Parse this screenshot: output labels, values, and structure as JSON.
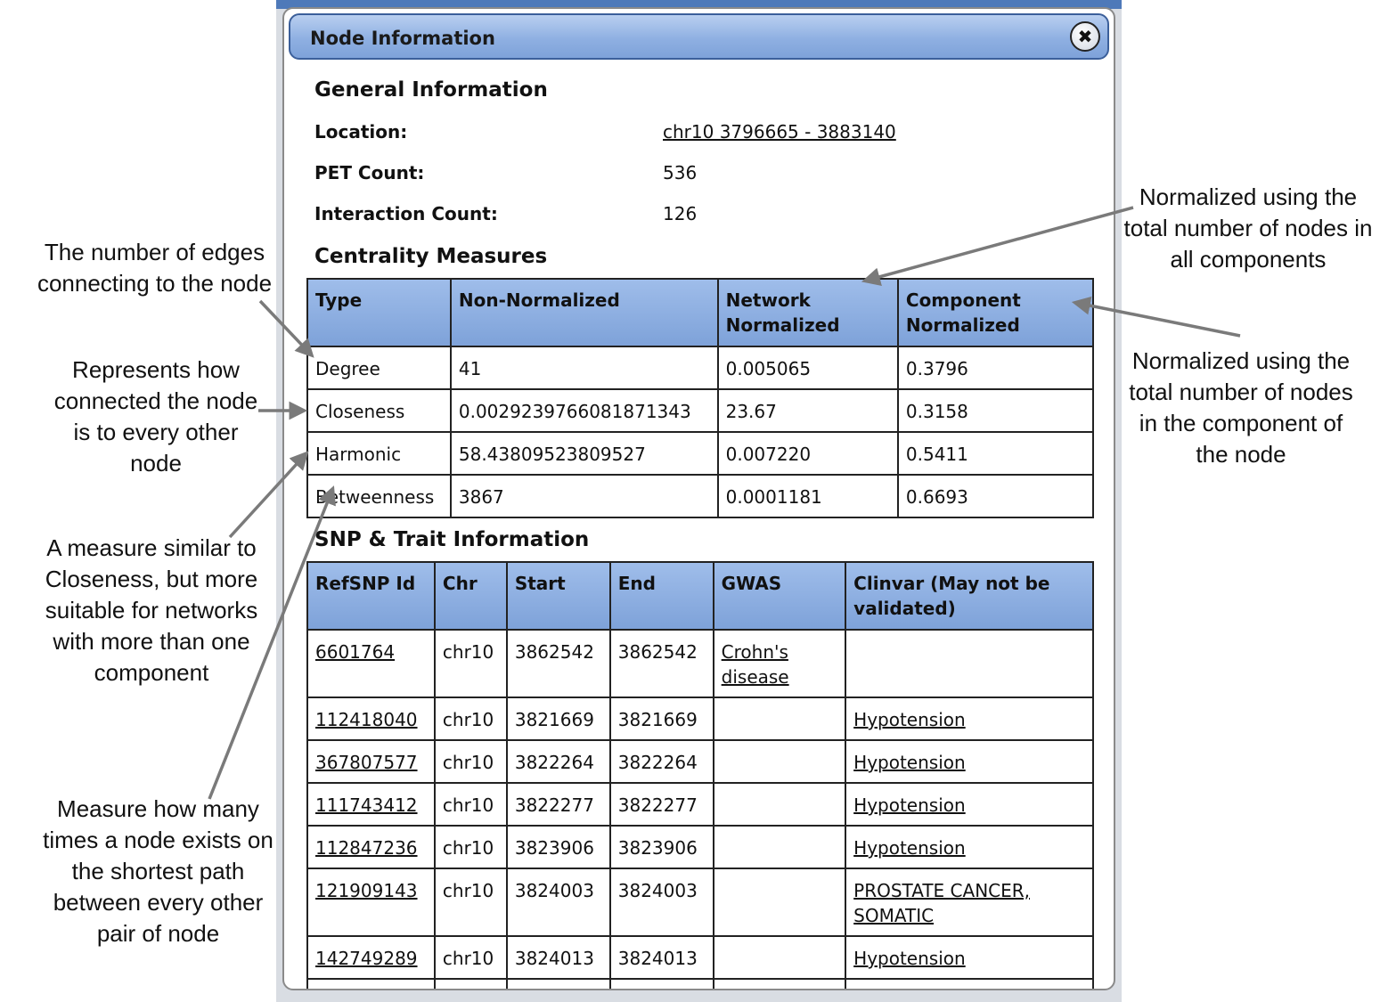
{
  "dialog": {
    "title": "Node Information",
    "close_icon": "✖"
  },
  "general": {
    "heading": "General Information",
    "location_label": "Location:",
    "location_value": "chr10 3796665 - 3883140",
    "pet_label": "PET Count:",
    "pet_value": "536",
    "interaction_label": "Interaction Count:",
    "interaction_value": "126"
  },
  "centrality": {
    "heading": "Centrality Measures",
    "columns": [
      "Type",
      "Non-Normalized",
      "Network Normalized",
      "Component Normalized"
    ],
    "rows": [
      [
        "Degree",
        "41",
        "0.005065",
        "0.3796"
      ],
      [
        "Closeness",
        "0.0029239766081871343",
        "23.67",
        "0.3158"
      ],
      [
        "Harmonic",
        "58.43809523809527",
        "0.007220",
        "0.5411"
      ],
      [
        "Betweenness",
        "3867",
        "0.0001181",
        "0.6693"
      ]
    ]
  },
  "snp": {
    "heading": "SNP & Trait Information",
    "columns": [
      "RefSNP Id",
      "Chr",
      "Start",
      "End",
      "GWAS",
      "Clinvar (May not be validated)"
    ],
    "rows": [
      [
        "6601764",
        "chr10",
        "3862542",
        "3862542",
        "Crohn's disease",
        ""
      ],
      [
        "112418040",
        "chr10",
        "3821669",
        "3821669",
        "",
        "Hypotension"
      ],
      [
        "367807577",
        "chr10",
        "3822264",
        "3822264",
        "",
        "Hypotension"
      ],
      [
        "111743412",
        "chr10",
        "3822277",
        "3822277",
        "",
        "Hypotension"
      ],
      [
        "112847236",
        "chr10",
        "3823906",
        "3823906",
        "",
        "Hypotension"
      ],
      [
        "121909143",
        "chr10",
        "3824003",
        "3824003",
        "",
        "PROSTATE CANCER, SOMATIC"
      ],
      [
        "142749289",
        "chr10",
        "3824013",
        "3824013",
        "",
        "Hypotension"
      ]
    ]
  },
  "annotations": {
    "degree": "The number of edges connecting to the node",
    "closeness": "Represents how connected the node is to every other node",
    "harmonic": "A measure similar to Closeness, but more suitable for networks with more than one component",
    "betweenness": "Measure how many times a node exists on the shortest path between every other pair of node",
    "network_normalized": "Normalized using the total number of nodes in all components",
    "component_normalized": "Normalized using the total number of nodes in the component of the node"
  }
}
